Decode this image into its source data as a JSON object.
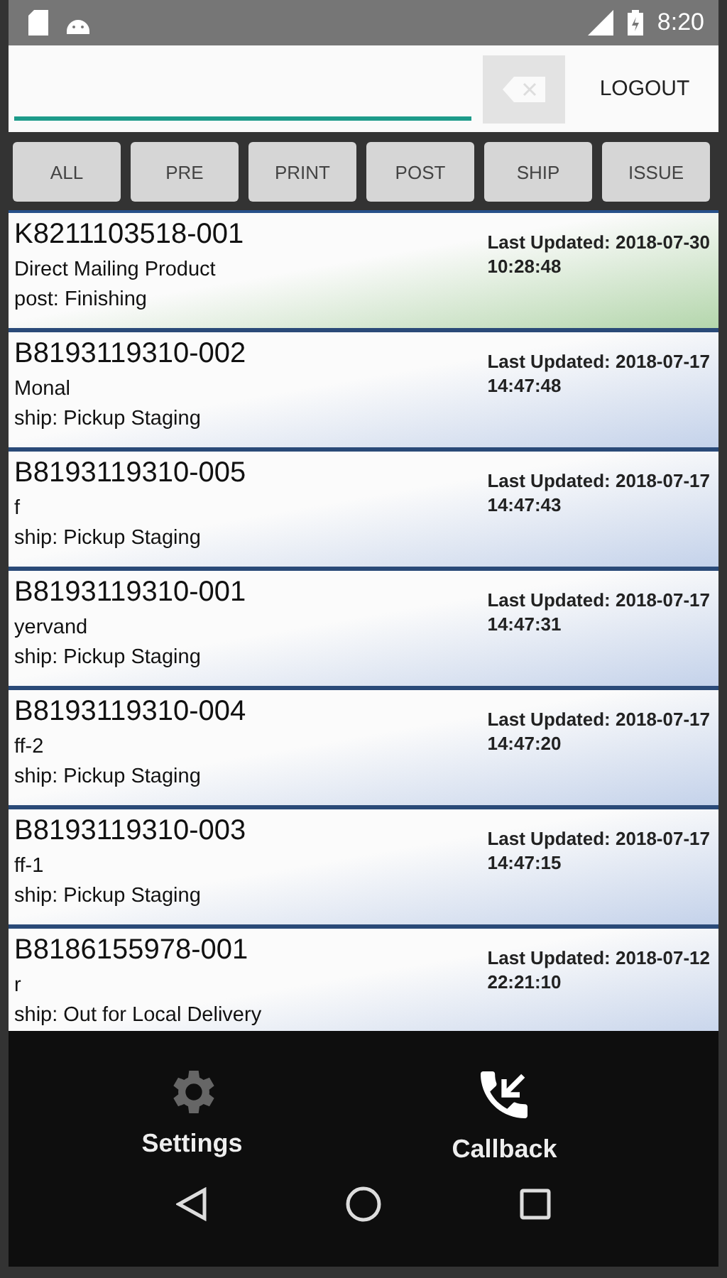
{
  "status_bar": {
    "time": "8:20"
  },
  "header": {
    "logout": "LOGOUT"
  },
  "filters": [
    {
      "label": "ALL"
    },
    {
      "label": "PRE"
    },
    {
      "label": "PRINT"
    },
    {
      "label": "POST"
    },
    {
      "label": "SHIP"
    },
    {
      "label": "ISSUE"
    }
  ],
  "orders": [
    {
      "id": "K8211103518-001",
      "name": "Direct Mailing Product",
      "status": "post: Finishing",
      "updated": "Last Updated: 2018-07-30",
      "time": "10:28:48",
      "color": "#b4d6ac"
    },
    {
      "id": "B8193119310-002",
      "name": "Monal",
      "status": "ship: Pickup Staging",
      "updated": "Last Updated: 2018-07-17",
      "time": "14:47:48",
      "color": "#c4d2ea"
    },
    {
      "id": "B8193119310-005",
      "name": "f",
      "status": "ship: Pickup Staging",
      "updated": "Last Updated: 2018-07-17",
      "time": "14:47:43",
      "color": "#c4d2ea"
    },
    {
      "id": "B8193119310-001",
      "name": "yervand",
      "status": "ship: Pickup Staging",
      "updated": "Last Updated: 2018-07-17",
      "time": "14:47:31",
      "color": "#c4d2ea"
    },
    {
      "id": "B8193119310-004",
      "name": "ff-2",
      "status": "ship: Pickup Staging",
      "updated": "Last Updated: 2018-07-17",
      "time": "14:47:20",
      "color": "#c4d2ea"
    },
    {
      "id": "B8193119310-003",
      "name": "ff-1",
      "status": "ship: Pickup Staging",
      "updated": "Last Updated: 2018-07-17",
      "time": "14:47:15",
      "color": "#c4d2ea"
    },
    {
      "id": "B8186155978-001",
      "name": "r",
      "status": "ship: Out for Local Delivery",
      "updated": "Last Updated: 2018-07-12",
      "time": "22:21:10",
      "color": "#c4d2ea"
    }
  ],
  "bottom_actions": [
    {
      "label": "Settings",
      "kind": "settings"
    },
    {
      "label": "Callback",
      "kind": "callback"
    }
  ]
}
